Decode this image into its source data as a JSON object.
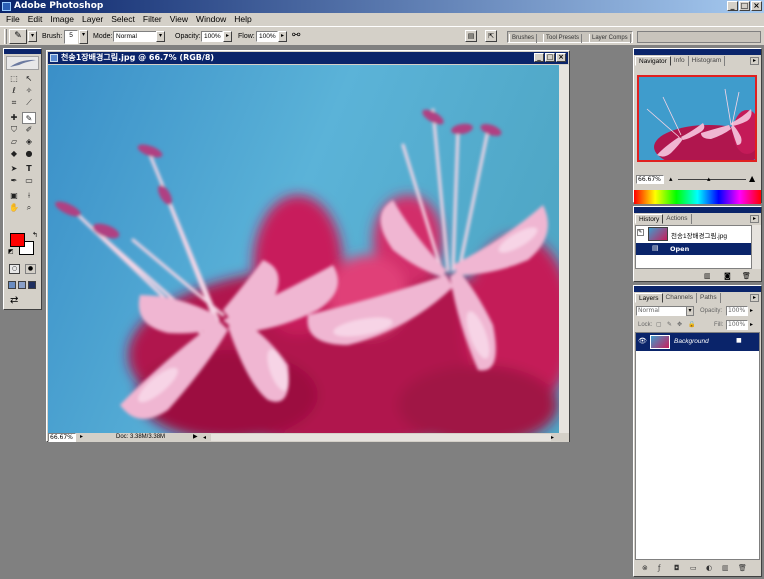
{
  "app": {
    "title": "Adobe Photoshop"
  },
  "menu": [
    "File",
    "Edit",
    "Image",
    "Layer",
    "Select",
    "Filter",
    "View",
    "Window",
    "Help"
  ],
  "options": {
    "brush_label": "Brush:",
    "brush_size": "5",
    "mode_label": "Mode:",
    "mode_value": "Normal",
    "opacity_label": "Opacity:",
    "opacity_value": "100%",
    "flow_label": "Flow:",
    "flow_value": "100%"
  },
  "palette_well": [
    "Brushes",
    "Tool Presets",
    "Layer Comps"
  ],
  "document": {
    "title": "천송1장배경그림.jpg @ 66.7% (RGB/8)",
    "zoom": "66.67%",
    "doc_info": "Doc: 3.38M/3.38M"
  },
  "navigator": {
    "tabs": [
      "Navigator",
      "Info",
      "Histogram"
    ],
    "zoom": "66.67%"
  },
  "history": {
    "tabs": [
      "History",
      "Actions"
    ],
    "snapshot": "천송1장배경그림.jpg",
    "steps": [
      "Open"
    ]
  },
  "layers": {
    "tabs": [
      "Layers",
      "Channels",
      "Paths"
    ],
    "blend_mode": "Normal",
    "opacity_label": "Opacity:",
    "opacity_value": "100%",
    "lock_label": "Lock:",
    "fill_label": "Fill:",
    "fill_value": "100%",
    "items": [
      "Background"
    ]
  },
  "colors": {
    "foreground": "#ff0000",
    "background": "#ffffff",
    "titlebar": "#0a246a"
  }
}
